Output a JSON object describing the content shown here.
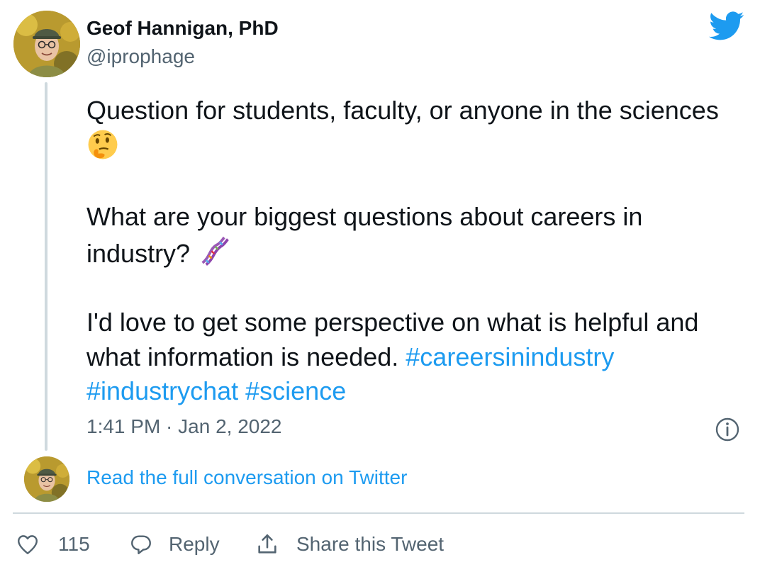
{
  "author": {
    "name": "Geof Hannigan, PhD",
    "handle": "@iprophage"
  },
  "brand": {
    "icon": "twitter-bird-icon",
    "color": "#1d9bf0"
  },
  "tweet": {
    "para1_text": "Question for students, faculty, or anyone in the sciences",
    "para1_emoji": "thinking-face-emoji",
    "para2_text": "What are your biggest questions about careers in industry?",
    "para2_emoji": "dna-emoji",
    "para3_text": "I'd love to get some perspective on what is helpful and what information is needed.",
    "hashtags": [
      "#careersinindustry",
      "#industrychat",
      "#science"
    ],
    "timestamp": "1:41 PM · Jan 2, 2022"
  },
  "conversation_link": "Read the full conversation on Twitter",
  "actions": {
    "like_icon": "heart-icon",
    "like_count": "115",
    "reply_icon": "reply-bubble-icon",
    "reply_label": "Reply",
    "share_icon": "share-icon",
    "share_label": "Share this Tweet"
  },
  "colors": {
    "text": "#0f1419",
    "secondary": "#536471",
    "link": "#1d9bf0",
    "divider": "#cfd9de"
  }
}
